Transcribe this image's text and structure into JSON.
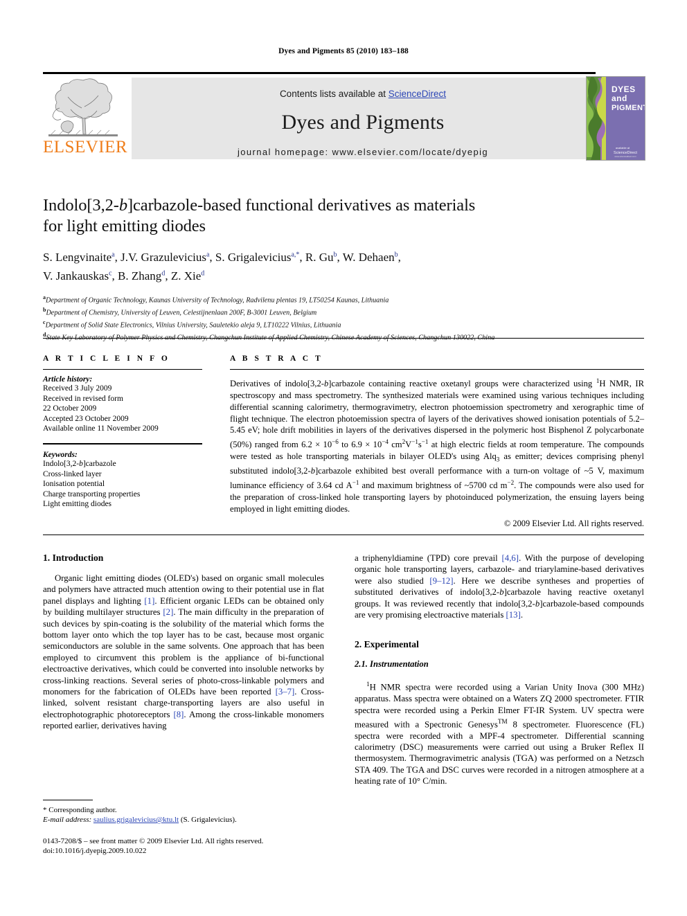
{
  "running_head": "Dyes and Pigments 85 (2010) 183–188",
  "masthead": {
    "publisher_name": "ELSEVIER",
    "contents_prefix": "Contents lists available at ",
    "contents_link": "ScienceDirect",
    "journal_title": "Dyes and Pigments",
    "homepage": "journal homepage: www.elsevier.com/locate/dyepig",
    "cover_line1": "DYES",
    "cover_line2": "and",
    "cover_line3": "PIGMENTS",
    "cover_footer": "ScienceDirect",
    "link_color": "#2b45b5",
    "band_color": "#e6e6e6",
    "elsevier_color": "#ef7d1a"
  },
  "article": {
    "title_line1": "Indolo[3,2-b]carbazole-based functional derivatives as materials",
    "title_line2": "for light emitting diodes",
    "authors_line1": "S. Lengvinaite a, J.V. Grazulevicius a, S. Grigalevicius a,*, R. Gu b, W. Dehaen b,",
    "authors_line2": "V. Jankauskas c, B. Zhang d, Z. Xie d",
    "affiliations": [
      {
        "mark": "a",
        "text": "Department of Organic Technology, Kaunas University of Technology, Radvilenu plentas 19, LT50254 Kaunas, Lithuania"
      },
      {
        "mark": "b",
        "text": "Department of Chemistry, University of Leuven, Celestijnenlaan 200F, B-3001 Leuven, Belgium"
      },
      {
        "mark": "c",
        "text": "Department of Solid State Electronics, Vilnius University, Sauletekio aleja 9, LT10222 Vilnius, Lithuania"
      },
      {
        "mark": "d",
        "text": "State Key Laboratory of Polymer Physics and Chemistry, Changchun Institute of Applied Chemistry, Chinese Academy of Sciences, Changchun 130022, China"
      }
    ]
  },
  "article_info": {
    "heading": "A R T I C L E   I N F O",
    "history_label": "Article history:",
    "history": [
      "Received 3 July 2009",
      "Received in revised form",
      "22 October 2009",
      "Accepted 23 October 2009",
      "Available online 11 November 2009"
    ],
    "keywords_label": "Keywords:",
    "keywords": [
      "Indolo[3,2-b]carbazole",
      "Cross-linked layer",
      "Ionisation potential",
      "Charge transporting properties",
      "Light emitting diodes"
    ]
  },
  "abstract": {
    "heading": "A B S T R A C T",
    "text": "Derivatives of indolo[3,2-b]carbazole containing reactive oxetanyl groups were characterized using 1H NMR, IR spectroscopy and mass spectrometry. The synthesized materials were examined using various techniques including differential scanning calorimetry, thermogravimetry, electron photoemission spectrometry and xerographic time of flight technique. The electron photoemission spectra of layers of the derivatives showed ionisation potentials of 5.2–5.45 eV; hole drift mobilities in layers of the derivatives dispersed in the polymeric host Bisphenol Z polycarbonate (50%) ranged from 6.2 × 10−6 to 6.9 × 10−4 cm2V−1s−1 at high electric fields at room temperature. The compounds were tested as hole transporting materials in bilayer OLED's using Alq3 as emitter; devices comprising phenyl substituted indolo[3,2-b]carbazole exhibited best overall performance with a turn-on voltage of ~5 V, maximum luminance efficiency of 3.64 cd A−1 and maximum brightness of ~5700 cd m−2. The compounds were also used for the preparation of cross-linked hole transporting layers by photoinduced polymerization, the ensuing layers being employed in light emitting diodes.",
    "copyright": "© 2009 Elsevier Ltd. All rights reserved."
  },
  "body": {
    "intro_heading": "1. Introduction",
    "intro_p1_left": "Organic light emitting diodes (OLED's) based on organic small molecules and polymers have attracted much attention owing to their potential use in flat panel displays and lighting [1]. Efficient organic LEDs can be obtained only by building multilayer structures [2]. The main difficulty in the preparation of such devices by spin-coating is the solubility of the material which forms the bottom layer onto which the top layer has to be cast, because most organic semiconductors are soluble in the same solvents. One approach that has been employed to circumvent this problem is the appliance of bi-functional electroactive derivatives, which could be converted into insoluble networks by cross-linking reactions. Several series of photo-cross-linkable polymers and monomers for the fabrication of OLEDs have been reported [3–7]. Cross-linked, solvent resistant charge-transporting layers are also useful in electrophotographic photoreceptors [8]. Among the cross-linkable monomers reported earlier, derivatives having",
    "intro_p1_right": "a triphenyldiamine (TPD) core prevail [4,6]. With the purpose of developing organic hole transporting layers, carbazole- and triarylamine-based derivatives were also studied [9–12]. Here we describe syntheses and properties of substituted derivatives of indolo[3,2-b]carbazole having reactive oxetanyl groups. It was reviewed recently that indolo[3,2-b]carbazole-based compounds are very promising electroactive materials [13].",
    "experimental_heading": "2. Experimental",
    "instrumentation_heading": "2.1. Instrumentation",
    "instrumentation_p1": "1H NMR spectra were recorded using a Varian Unity Inova (300 MHz) apparatus. Mass spectra were obtained on a Waters ZQ 2000 spectrometer. FTIR spectra were recorded using a Perkin Elmer FT-IR System. UV spectra were measured with a Spectronic GenesysTM 8 spectrometer. Fluorescence (FL) spectra were recorded with a MPF-4 spectrometer. Differential scanning calorimetry (DSC) measurements were carried out using a Bruker Reflex II thermosystem. Thermogravimetric analysis (TGA) was performed on a Netzsch STA 409. The TGA and DSC curves were recorded in a nitrogen atmosphere at a heating rate of 10° C/min."
  },
  "footnote": {
    "corresponding": "* Corresponding author.",
    "email_label": "E-mail address:",
    "email": "saulius.grigalevicius@ktu.lt",
    "email_owner": "(S. Grigalevicius)."
  },
  "imprint": {
    "line1": "0143-7208/$ – see front matter © 2009 Elsevier Ltd. All rights reserved.",
    "line2": "doi:10.1016/j.dyepig.2009.10.022"
  }
}
